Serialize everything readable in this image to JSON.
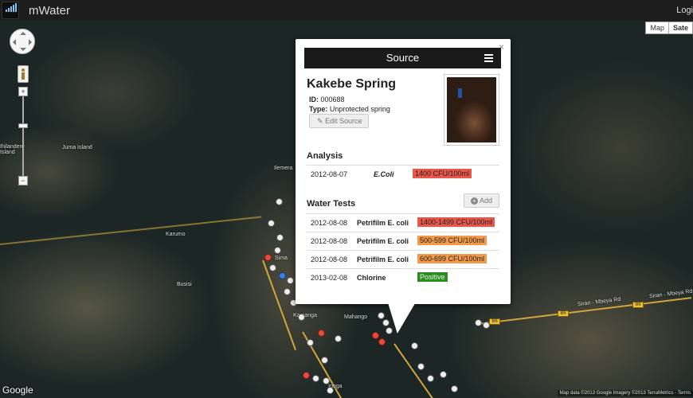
{
  "app": {
    "title": "mWater",
    "login_label": "Logi"
  },
  "map": {
    "type_buttons": [
      "Map",
      "Sate"
    ],
    "google_label": "Google",
    "attribution": "Map data ©2013 Google Imagery ©2013 TerraMetrics - Terms",
    "place_labels": [
      "Juma Island",
      "Ihilandere Island",
      "Karumo",
      "Busisi",
      "Ilemera",
      "Mahango",
      "Sima",
      "Kamanga",
      "Igoga"
    ],
    "road_tags": [
      "B6",
      "B6",
      "B6"
    ],
    "road_names": [
      "Siran - Mbeya Rd",
      "Siran - Mbeya Rd"
    ]
  },
  "popup": {
    "header": "Source",
    "name": "Kakebe Spring",
    "id_label": "ID:",
    "id_value": "000688",
    "type_label": "Type:",
    "type_value": "Unprotected spring",
    "edit_label": "Edit Source",
    "analysis_title": "Analysis",
    "analysis": [
      {
        "date": "2012-08-07",
        "param": "E.Coli",
        "value": "1400 CFU/100ml",
        "color": "#e8574a"
      }
    ],
    "tests_title": "Water Tests",
    "add_label": "Add",
    "tests": [
      {
        "date": "2012-08-08",
        "param": "Petrifilm E. coli",
        "value": "1400-1499 CFU/100ml",
        "color": "#e8574a"
      },
      {
        "date": "2012-08-08",
        "param": "Petrifilm E. coli",
        "value": "500-599 CFU/100ml",
        "color": "#f39a4a"
      },
      {
        "date": "2012-08-08",
        "param": "Petrifilm E. coli",
        "value": "600-699 CFU/100ml",
        "color": "#f39a4a"
      },
      {
        "date": "2013-02-08",
        "param": "Chlorine",
        "value": "Positive",
        "color": "#2f8a1e"
      }
    ]
  }
}
